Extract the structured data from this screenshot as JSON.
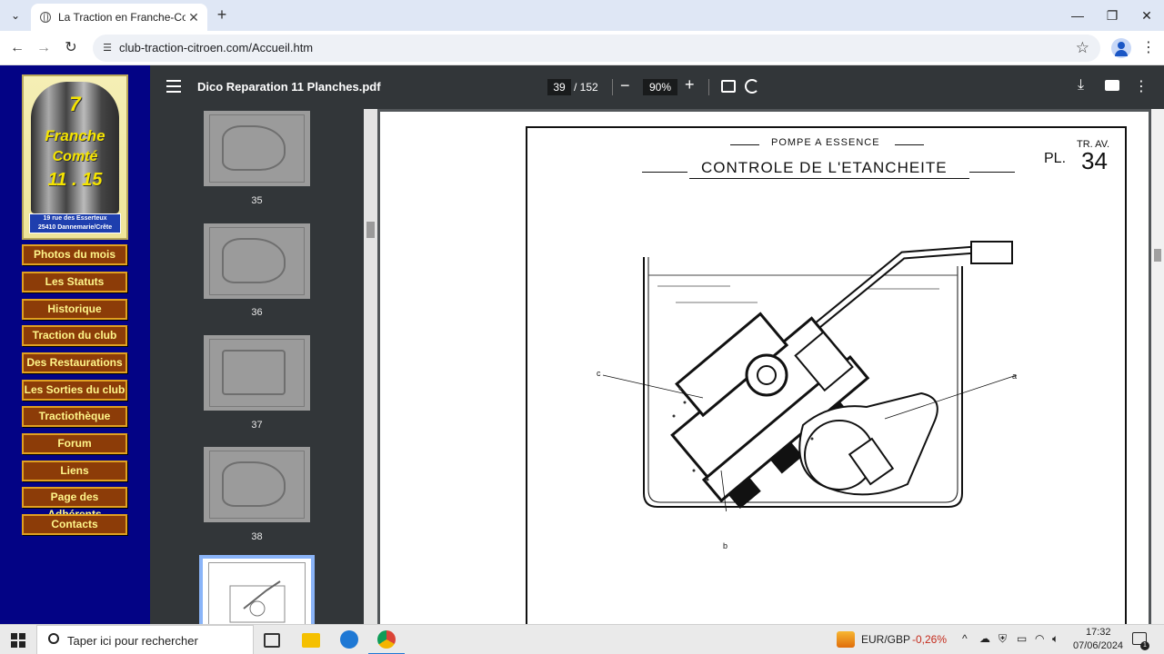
{
  "browser": {
    "tab_title": "La Traction en Franche-Comté",
    "url": "club-traction-citroen.com/Accueil.htm"
  },
  "site": {
    "logo": {
      "line1": "7",
      "line2": "Franche",
      "line3": "Comté",
      "line4": "11 . 15",
      "address1": "19 rue des Esserteux",
      "address2": "25410 Dannemarie/Crête"
    },
    "menu": [
      {
        "label": "Photos du mois"
      },
      {
        "label": "Les Statuts"
      },
      {
        "label": "Historique"
      },
      {
        "label": "Traction du club"
      },
      {
        "label": "Des Restaurations"
      },
      {
        "label": "Les Sorties du club"
      },
      {
        "label": "Tractiothèque"
      },
      {
        "label": "Forum"
      },
      {
        "label": "Liens"
      },
      {
        "label": "Page des Adhérents"
      },
      {
        "label": "Contacts"
      }
    ]
  },
  "pdf": {
    "filename": "Dico Reparation 11 Planches.pdf",
    "current_page": "39",
    "total_pages": "/ 152",
    "zoom": "90%",
    "thumbnails": [
      {
        "page": "35"
      },
      {
        "page": "36"
      },
      {
        "page": "37"
      },
      {
        "page": "38"
      }
    ],
    "plate": {
      "subtitle": "POMPE A ESSENCE",
      "title": "CONTROLE DE L'ETANCHEITE",
      "section": "TR. AV.",
      "pl_label": "PL.",
      "pl_number": "34",
      "label_a": "a",
      "label_b": "b",
      "label_c": "c"
    }
  },
  "taskbar": {
    "search_placeholder": "Taper ici pour rechercher",
    "ticker_label": "EUR/GBP",
    "ticker_change": "-0,26%",
    "time": "17:32",
    "date": "07/06/2024",
    "notification_count": "1"
  }
}
